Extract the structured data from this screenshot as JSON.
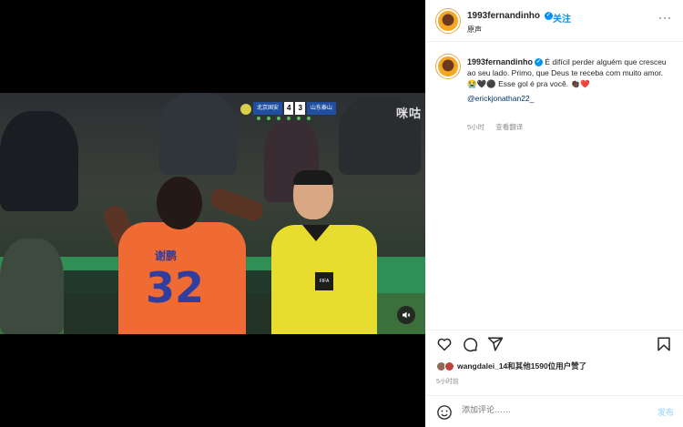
{
  "video": {
    "scorebug": {
      "home_team": "北京国安",
      "home_score": "4",
      "away_score": "3",
      "away_team": "山东泰山"
    },
    "watermark": "咪咕",
    "player_number": "32",
    "player_name": "谢鹏",
    "referee_badge": "FIFA",
    "sound_icon": "speaker-muted-icon"
  },
  "post": {
    "header": {
      "username": "1993fernandinho",
      "verified": "✓",
      "separator": "·",
      "follow_label": "关注",
      "subtitle": "原声",
      "more": "···"
    },
    "caption": {
      "username": "1993fernandinho",
      "text": "É difícil perder alguém que cresceu ao seu lado. Primo, que Deus te receba com muito amor. 😭🖤⚫ Esse gol é pra você. 👏🏿❤️",
      "mention": "@erickjonathan22_",
      "time": "5小时",
      "translate": "查看翻译"
    },
    "actions": {
      "like_icon": "heart-icon",
      "comment_icon": "comment-icon",
      "share_icon": "share-icon",
      "save_icon": "bookmark-icon"
    },
    "likes_text": "wangdalei_14和其他1590位用户赞了",
    "time_ago": "5小时前",
    "comment": {
      "placeholder": "添加评论……",
      "post_label": "发布",
      "emoji_icon": "smile-icon"
    }
  },
  "colors": {
    "accent_blue": "#0095f6",
    "jersey_orange": "#f06a33",
    "referee_yellow": "#e8dc2e"
  }
}
